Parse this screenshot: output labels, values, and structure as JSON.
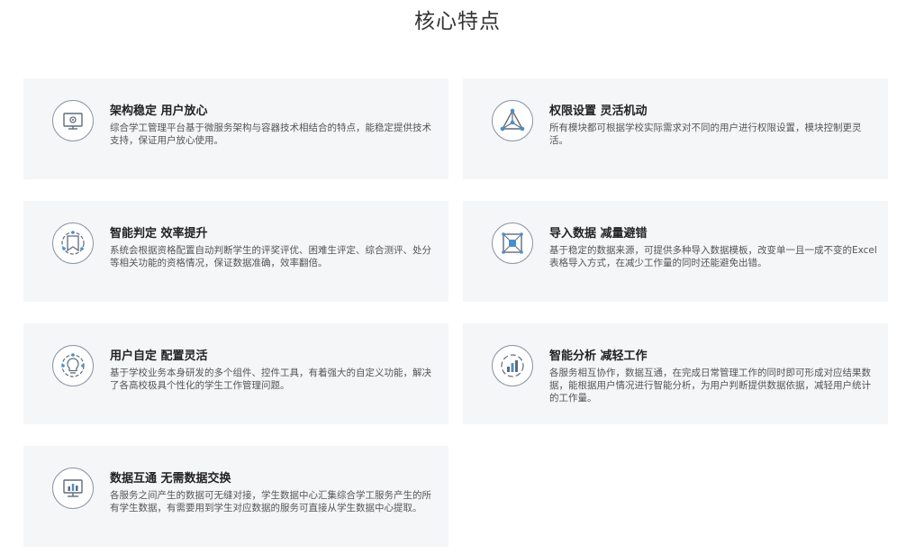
{
  "section": {
    "title": "核心特点"
  },
  "features": [
    {
      "icon": "monitor-icon",
      "title": "架构稳定 用户放心",
      "desc": "综合学工管理平台基于微服务架构与容器技术相结合的特点，能稳定提供技术支持，保证用户放心使用。"
    },
    {
      "icon": "triangle-network-icon",
      "title": "权限设置 灵活机动",
      "desc": "所有模块都可根据学校实际需求对不同的用户进行权限设置，模块控制更灵活。"
    },
    {
      "icon": "document-judge-icon",
      "title": "智能判定 效率提升",
      "desc": "系统会根据资格配置自动判断学生的评奖评优、困难生评定、综合测评、处分等相关功能的资格情况，保证数据准确，效率翻倍。"
    },
    {
      "icon": "data-import-icon",
      "title": "导入数据 减量避错",
      "desc": "基于稳定的数据来源，可提供多种导入数据模板，改变单一且一成不变的Excel表格导入方式，在减少工作量的同时还能避免出错。"
    },
    {
      "icon": "lightbulb-gear-icon",
      "title": "用户自定 配置灵活",
      "desc": "基于学校业务本身研发的多个组件、控件工具，有着强大的自定义功能，解决了各高校极具个性化的学生工作管理问题。"
    },
    {
      "icon": "bar-chart-circle-icon",
      "title": "智能分析 减轻工作",
      "desc": "各服务相互协作，数据互通，在完成日常管理工作的同时即可形成对应结果数据，能根据用户情况进行智能分析，为用户判断提供数据依据，减轻用户统计的工作量。"
    },
    {
      "icon": "monitor-chart-icon",
      "title": "数据互通 无需数据交换",
      "desc": "各服务之间产生的数据可无缝对接，学生数据中心汇集综合学工服务产生的所有学生数据，有需要用到学生对应数据的服务可直接从学生数据中心提取。"
    }
  ]
}
